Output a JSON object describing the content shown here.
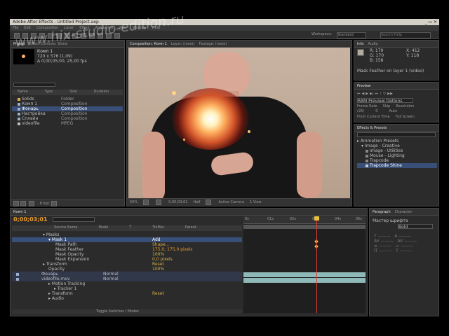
{
  "window": {
    "title": "Adobe After Effects - Untitled Project.aep"
  },
  "menu": [
    "File",
    "Edit",
    "Composition",
    "Layer",
    "Effect",
    "Animation",
    "View",
    "Window",
    "Help"
  ],
  "toolbar": {
    "workspace_label": "Workspace:",
    "workspace_value": "Standard",
    "search_placeholder": "Search Help"
  },
  "watermark": "www.hix-studio-edition.ru",
  "project": {
    "tab": "Project",
    "tab2": "Effect Controls: Shine",
    "item_name": "Комп 1",
    "item_info": [
      "720 x 576 (1,09)",
      "Δ 0;00;05;00, 25,00 fps"
    ],
    "columns": [
      "Name",
      "Type",
      "Size",
      "Duration"
    ],
    "items": [
      {
        "name": "Solids",
        "type": "Folder",
        "color": "#d9b04a"
      },
      {
        "name": "Комп 1",
        "type": "Composition",
        "color": "#9ab0d0"
      },
      {
        "name": "Фонарь",
        "type": "Composition",
        "color": "#9ab0d0",
        "selected": true
      },
      {
        "name": "Настройка",
        "type": "Composition",
        "color": "#9ab0d0"
      },
      {
        "name": "Сплайн",
        "type": "Composition",
        "color": "#9ab0d0"
      },
      {
        "name": "videofile",
        "type": "MPEG",
        "color": "#c0c0c0"
      }
    ],
    "bpc": "8 bpc"
  },
  "comp": {
    "tab": "Composition: Комп 1",
    "tab2": "Layer: (none)",
    "tab3": "Footage: (none)",
    "zoom": "50%",
    "timecode": "0;00;03;01",
    "quality": "Half",
    "view": "Active Camera",
    "views": "1 View"
  },
  "info": {
    "tab": "Info",
    "tab2": "Audio",
    "values": [
      "R: 179",
      "G: 170",
      "B: 158",
      "A: 255"
    ],
    "coords": [
      "X: 412",
      "Y: 118"
    ],
    "note": "Mask Feather on layer 1 (video)"
  },
  "preview": {
    "tab": "Preview",
    "ram_label": "RAM Preview Options",
    "frame_rate_label": "Frame Rate",
    "skip_label": "Skip",
    "resolution_label": "Resolution",
    "frame_rate": "(25)",
    "skip": "0",
    "resolution": "Auto",
    "from_current": "From Current Time",
    "full_screen": "Full Screen"
  },
  "effects": {
    "tab": "Effects & Presets",
    "search_placeholder": "",
    "items": [
      "Animation Presets",
      "Image - Creative",
      "Image - Utilities",
      "Mouse - Lighting",
      "Trapcode",
      "Trapcode Shine"
    ]
  },
  "timeline": {
    "tab": "Комп 1",
    "timecode": "0;00;03;01",
    "columns": [
      "Source Name",
      "Mode",
      "T",
      "TrkMat",
      "Parent"
    ],
    "rows": [
      {
        "indent": 0,
        "label": "Masks",
        "value": ""
      },
      {
        "indent": 1,
        "label": "Mask 1",
        "value": "Add",
        "sel": true
      },
      {
        "indent": 2,
        "label": "Mask Path",
        "value": "Shape..."
      },
      {
        "indent": 2,
        "label": "Mask Feather",
        "value": "175,0; 175,0 pixels"
      },
      {
        "indent": 2,
        "label": "Mask Opacity",
        "value": "100%"
      },
      {
        "indent": 2,
        "label": "Mask Expansion",
        "value": "0,0 pixels"
      },
      {
        "indent": 0,
        "label": "Transform",
        "value": "Reset"
      },
      {
        "indent": 0,
        "label": "Opacity",
        "value": "100%"
      },
      {
        "indent": 0,
        "label": "Фонарь",
        "value": "Normal",
        "layer": true
      },
      {
        "indent": 0,
        "label": "videofile.mov",
        "value": "Normal",
        "layer": true
      },
      {
        "indent": 1,
        "label": "Motion Tracking",
        "value": ""
      },
      {
        "indent": 1,
        "label": "Tracker 1",
        "value": ""
      },
      {
        "indent": 1,
        "label": "Transform",
        "value": "Reset"
      },
      {
        "indent": 1,
        "label": "Audio",
        "value": ""
      }
    ],
    "ruler": [
      "0s",
      "01s",
      "02s",
      "03s",
      "04s",
      "05s"
    ],
    "playhead": 0.6,
    "footer": "Toggle Switches / Modes"
  },
  "paragraph": {
    "tab": "Paragraph",
    "tab2": "Character",
    "font_label": "Мастер шрифта",
    "font_value": "Bold"
  }
}
